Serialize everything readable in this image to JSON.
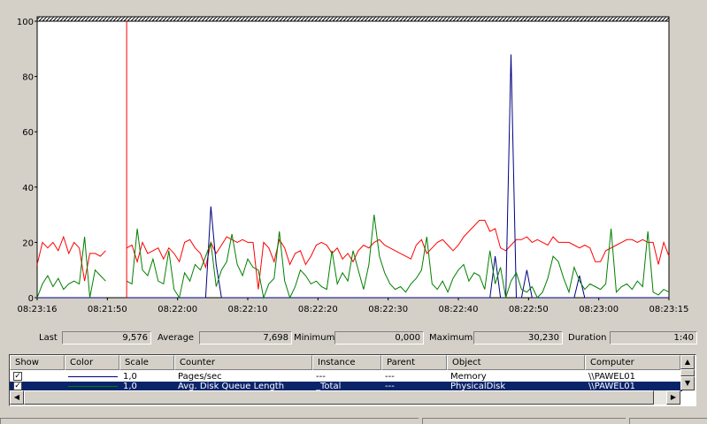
{
  "chart_data": {
    "type": "line",
    "xlabel": "",
    "ylabel": "",
    "ylim": [
      0,
      100
    ],
    "yticks": [
      "0",
      "20",
      "40",
      "60",
      "80",
      "100"
    ],
    "xticks": [
      "08:23:16",
      "08:21:50",
      "08:22:00",
      "08:22:10",
      "08:22:20",
      "08:22:30",
      "08:22:40",
      "08:22:50",
      "08:23:00",
      "08:23:15"
    ],
    "grid": false,
    "current_time_marker_index": 17,
    "series": [
      {
        "color": "#ff0000",
        "values": [
          12,
          20,
          18,
          20,
          17,
          22,
          16,
          20,
          18,
          6,
          16,
          16,
          15,
          17,
          null,
          null,
          null,
          18,
          19,
          13,
          20,
          16,
          17,
          18,
          14,
          18,
          16,
          13,
          20,
          21,
          18,
          16,
          11,
          20,
          16,
          19,
          22,
          21,
          20,
          21,
          20,
          20,
          3,
          20,
          18,
          13,
          21,
          18,
          12,
          16,
          17,
          12,
          15,
          19,
          20,
          19,
          16,
          18,
          14,
          16,
          13,
          17,
          19,
          18,
          20,
          21,
          19,
          18,
          17,
          16,
          15,
          14,
          19,
          21,
          16,
          18,
          20,
          21,
          19,
          17,
          19,
          22,
          24,
          26,
          28,
          28,
          24,
          25,
          18,
          17,
          19,
          21,
          21,
          22,
          20,
          21,
          20,
          19,
          22,
          20,
          20,
          20,
          19,
          18,
          19,
          18,
          13,
          13,
          17,
          18,
          19,
          20,
          21,
          21,
          20,
          21,
          20,
          20,
          12,
          20,
          15
        ]
      },
      {
        "color": "#000080",
        "values": [
          0,
          0,
          0,
          0,
          0,
          0,
          0,
          0,
          0,
          0,
          0,
          0,
          0,
          0,
          null,
          null,
          null,
          0,
          0,
          0,
          0,
          0,
          0,
          0,
          0,
          0,
          0,
          0,
          0,
          0,
          0,
          0,
          0,
          33,
          12,
          0,
          0,
          0,
          0,
          0,
          0,
          0,
          0,
          0,
          0,
          0,
          0,
          0,
          0,
          0,
          0,
          0,
          0,
          0,
          0,
          0,
          0,
          0,
          0,
          0,
          0,
          0,
          0,
          0,
          0,
          0,
          0,
          0,
          0,
          0,
          0,
          0,
          0,
          0,
          0,
          0,
          0,
          0,
          0,
          0,
          0,
          0,
          0,
          0,
          0,
          0,
          0,
          15,
          0,
          0,
          88,
          0,
          0,
          10,
          0,
          0,
          0,
          0,
          0,
          0,
          0,
          0,
          0,
          8,
          0,
          0,
          0,
          0,
          0,
          0,
          0,
          0,
          0,
          0,
          0,
          0,
          0,
          0,
          0,
          0,
          0
        ]
      },
      {
        "color": "#008000",
        "values": [
          0,
          5,
          8,
          4,
          7,
          3,
          5,
          6,
          5,
          22,
          0,
          10,
          8,
          6,
          null,
          null,
          null,
          6,
          5,
          25,
          10,
          8,
          14,
          6,
          5,
          17,
          3,
          0,
          9,
          6,
          12,
          10,
          15,
          20,
          4,
          10,
          13,
          23,
          12,
          8,
          14,
          11,
          10,
          0,
          5,
          7,
          24,
          6,
          0,
          4,
          10,
          8,
          5,
          6,
          4,
          3,
          17,
          5,
          9,
          6,
          17,
          10,
          3,
          12,
          30,
          15,
          9,
          5,
          3,
          4,
          2,
          5,
          7,
          10,
          22,
          5,
          3,
          6,
          2,
          7,
          10,
          12,
          6,
          9,
          8,
          3,
          17,
          5,
          11,
          0,
          6,
          9,
          3,
          2,
          4,
          0,
          2,
          7,
          15,
          13,
          7,
          2,
          11,
          6,
          3,
          5,
          4,
          3,
          5,
          25,
          2,
          4,
          5,
          3,
          6,
          4,
          24,
          2,
          1,
          3,
          2
        ]
      }
    ]
  },
  "stats": {
    "last_label": "Last",
    "last_value": "9,576",
    "average_label": "Average",
    "average_value": "7,698",
    "minimum_label": "Minimum",
    "minimum_value": "0,000",
    "maximum_label": "Maximum",
    "maximum_value": "30,230",
    "duration_label": "Duration",
    "duration_value": "1:40"
  },
  "legend": {
    "headers": [
      "Show",
      "Color",
      "Scale",
      "Counter",
      "Instance",
      "Parent",
      "Object",
      "Computer"
    ],
    "rows": [
      {
        "show": true,
        "color": "#000080",
        "scale": "1,0",
        "counter": "Pages/sec",
        "instance": "---",
        "parent": "---",
        "object": "Memory",
        "computer": "\\\\PAWEL01",
        "selected": false
      },
      {
        "show": true,
        "color": "#008000",
        "scale": "1,0",
        "counter": "Avg. Disk Queue Length",
        "instance": "_Total",
        "parent": "---",
        "object": "PhysicalDisk",
        "computer": "\\\\PAWEL01",
        "selected": true
      }
    ]
  },
  "icons": {
    "scroll_up": "up-arrow-icon",
    "scroll_down": "down-arrow-icon",
    "scroll_left": "left-arrow-icon",
    "scroll_right": "right-arrow-icon",
    "check": "checkmark-icon"
  }
}
